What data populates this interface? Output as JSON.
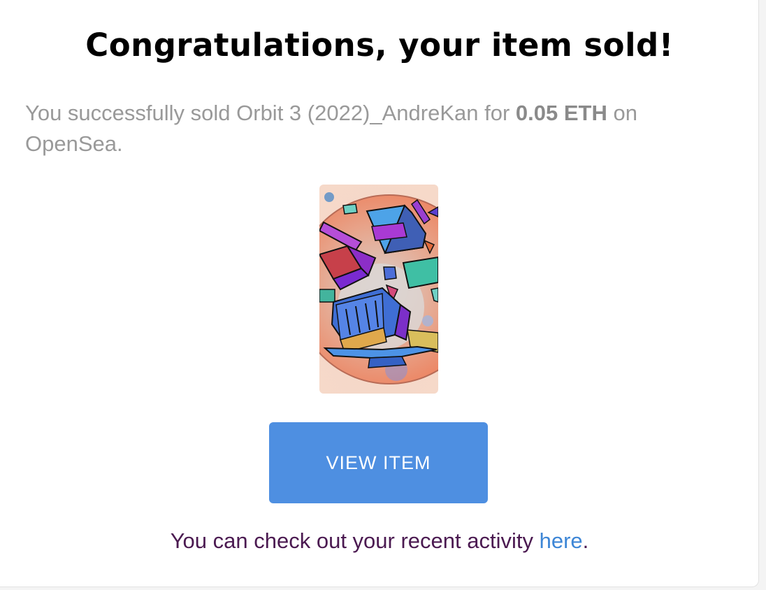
{
  "heading": "Congratulations, your item sold!",
  "message": {
    "prefix": "You successfully sold Orbit 3 (2022)_AndreKan for ",
    "price": "0.05 ETH",
    "suffix": " on OpenSea."
  },
  "artwork": {
    "alt": "Orbit 3 (2022)_AndreKan artwork",
    "icon": "nft-artwork-image"
  },
  "button": {
    "label": "VIEW ITEM"
  },
  "footer": {
    "prefix": "You can check out your recent activity ",
    "link": "here",
    "suffix": "."
  },
  "colors": {
    "button_bg": "#4e8fe1",
    "link": "#3d86d6",
    "footer_text": "#4b1a51",
    "message_text": "#999999"
  }
}
